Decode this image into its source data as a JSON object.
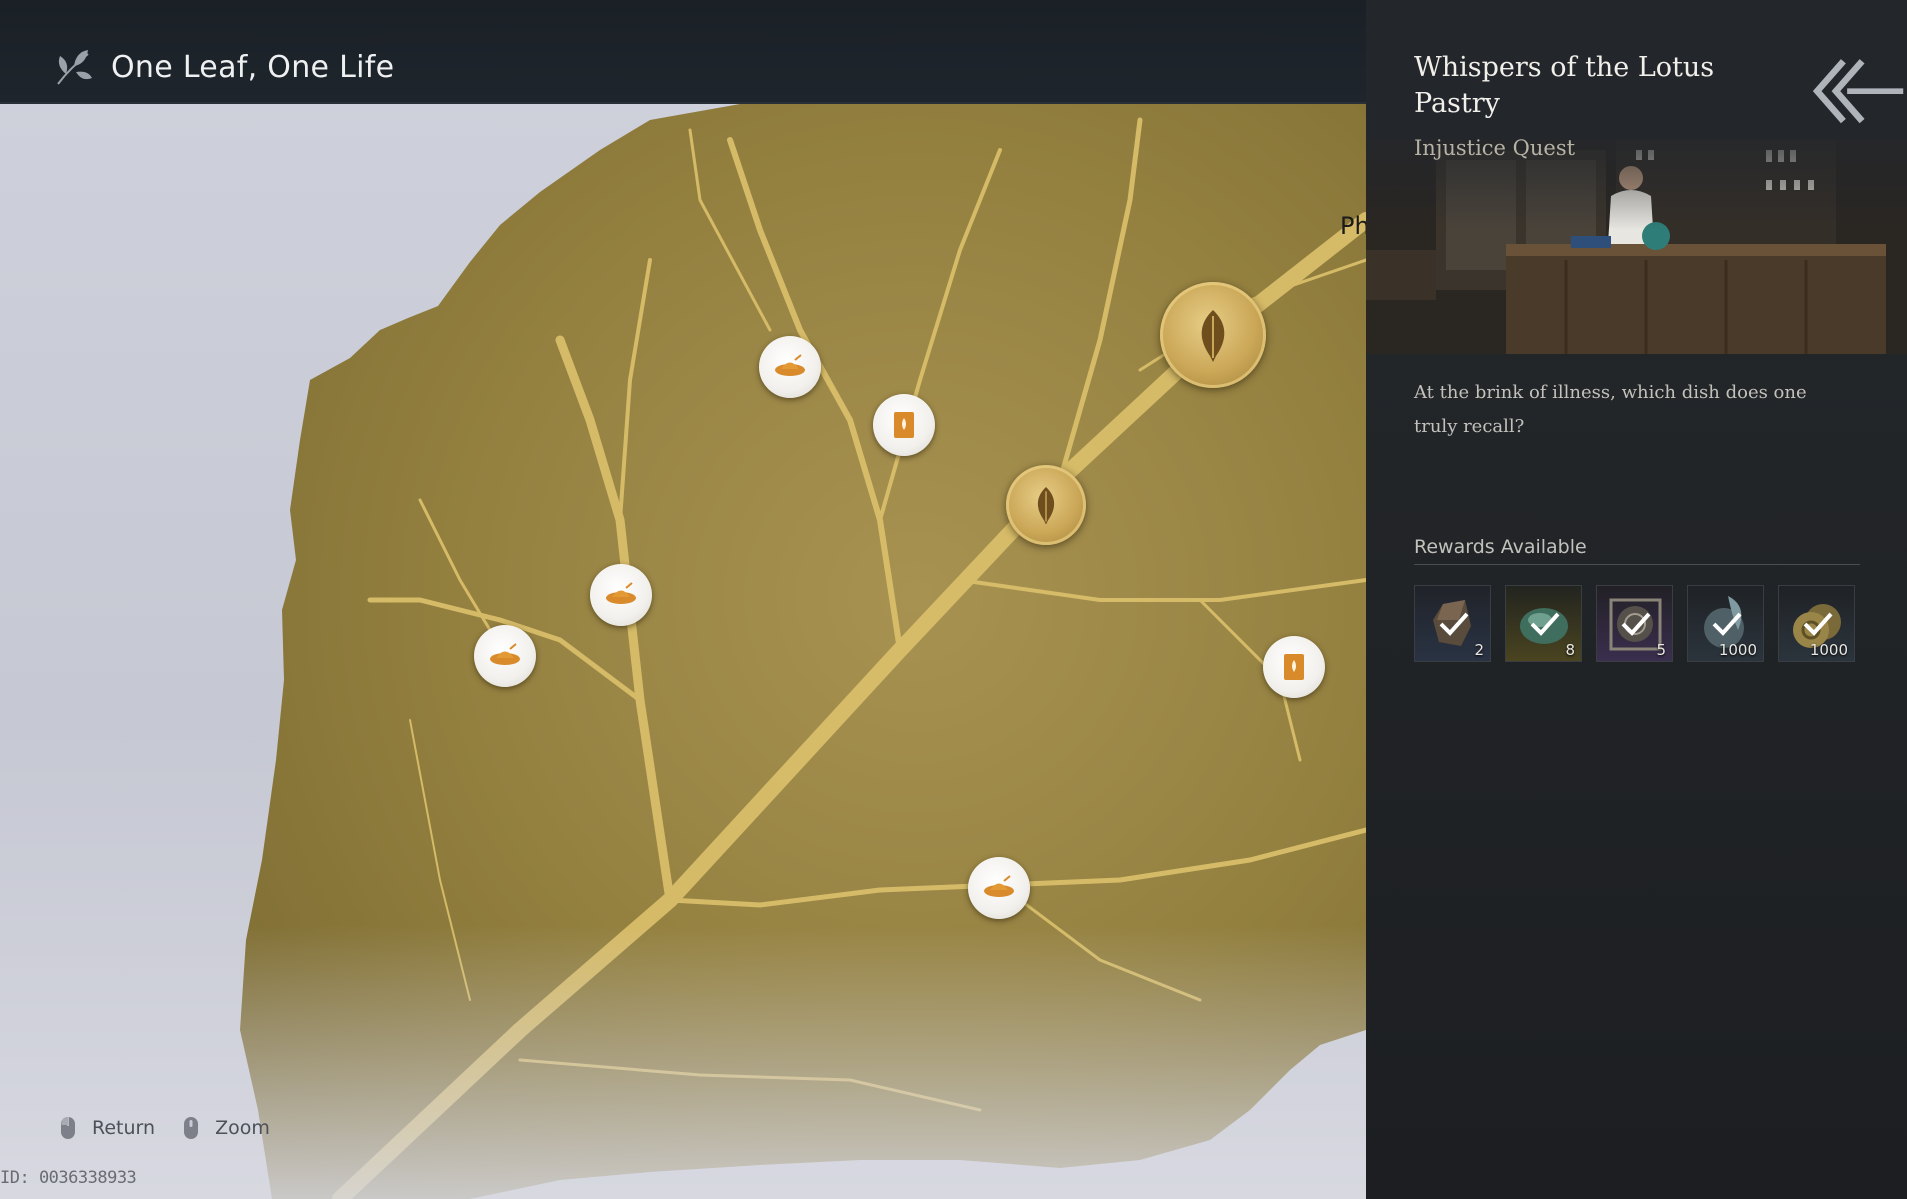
{
  "header": {
    "title": "One Leaf, One Life",
    "icon": "leaf-branch-icon"
  },
  "map": {
    "partial_label": "Ph",
    "nodes": [
      {
        "kind": "quest",
        "icon": "straw-hat-icon"
      },
      {
        "kind": "book",
        "icon": "book-icon"
      },
      {
        "kind": "leaf-large",
        "icon": "leaf-icon"
      },
      {
        "kind": "leaf",
        "icon": "leaf-icon"
      },
      {
        "kind": "quest",
        "icon": "straw-hat-icon"
      },
      {
        "kind": "quest",
        "icon": "straw-hat-icon"
      },
      {
        "kind": "book",
        "icon": "book-icon"
      },
      {
        "kind": "quest",
        "icon": "straw-hat-icon"
      }
    ]
  },
  "controls": {
    "return_label": "Return",
    "zoom_label": "Zoom"
  },
  "uid": "ID: 0036338933",
  "panel": {
    "quest_title": "Whispers of the Lotus Pastry",
    "quest_type": "Injustice Quest",
    "description": "At the brink of illness, which dish does one truly recall?",
    "rewards_title": "Rewards Available",
    "rewards": [
      {
        "count": "2",
        "icon": "ore-icon",
        "rarity_color": "#3b4a6a"
      },
      {
        "count": "8",
        "icon": "jade-stone-icon",
        "rarity_color": "#6a5a22"
      },
      {
        "count": "5",
        "icon": "compass-token-icon",
        "rarity_color": "#4a3b6a"
      },
      {
        "count": "1000",
        "icon": "feather-coin-icon",
        "rarity_color": "#2f3a44"
      },
      {
        "count": "1000",
        "icon": "coin-stack-icon",
        "rarity_color": "#2f3a44"
      }
    ]
  },
  "colors": {
    "leaf_gold": "#a08a4a",
    "vein_gold": "#d9be6a",
    "panel_bg": "#222528",
    "topbar_bg": "#1e252c"
  }
}
